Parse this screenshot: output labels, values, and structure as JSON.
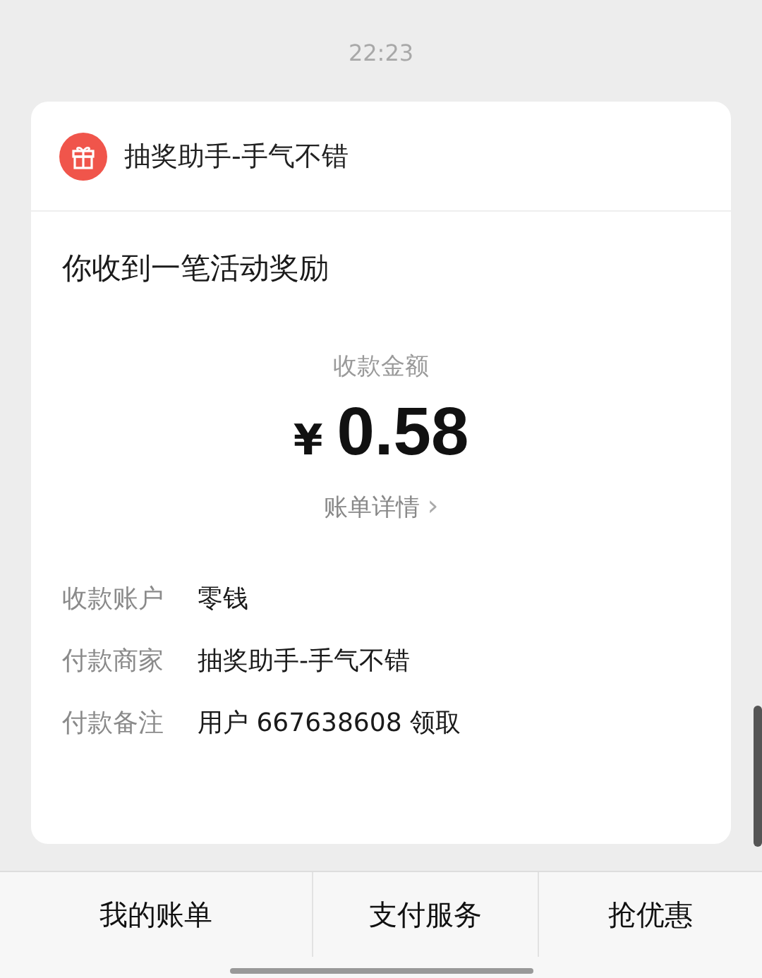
{
  "timestamp": "22:23",
  "card": {
    "sender": "抽奖助手-手气不错",
    "message": "你收到一笔活动奖励",
    "amount_label": "收款金额",
    "currency": "¥",
    "amount": "0.58",
    "details_link": "账单详情",
    "details_chevron": "›",
    "fields": [
      {
        "label": "收款账户",
        "value": "零钱"
      },
      {
        "label": "付款商家",
        "value": "抽奖助手-手气不错"
      },
      {
        "label": "付款备注",
        "value": "用户 667638608 领取"
      }
    ]
  },
  "bottom_menu": [
    "我的账单",
    "支付服务",
    "抢优惠"
  ]
}
